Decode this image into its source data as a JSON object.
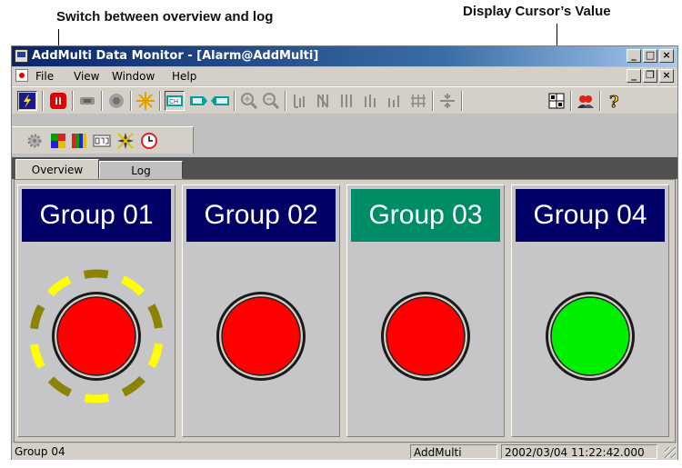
{
  "callouts": {
    "tabs_note": "Switch between overview and log",
    "cursor_note": "Display Cursor’s Value"
  },
  "window": {
    "title": "AddMulti Data Monitor - [Alarm@AddMulti]",
    "controls": {
      "minimize": "_",
      "maximize": "□",
      "close": "×",
      "restore": "❐"
    }
  },
  "menubar": {
    "items": [
      "File",
      "View",
      "Window",
      "Help"
    ]
  },
  "toolbar1": {
    "icons": [
      "alarm-lightning-icon",
      "stop-icon",
      "pause-icon",
      "record-icon",
      "sparkle-icon",
      "channel-icon",
      "tag-icon",
      "tag-comment-icon",
      "zoom-in-icon",
      "zoom-out-icon",
      "bar-scale-1-icon",
      "bar-scale-2-icon",
      "bar-scale-3-icon",
      "bar-scale-4-icon",
      "bar-scale-5-icon",
      "bar-scale-6-icon",
      "center-line-icon",
      "cursor-value-icon",
      "users-icon",
      "help-icon"
    ]
  },
  "toolbar2": {
    "icons": [
      "settings-gear-icon",
      "color-grid-icon",
      "color-bars-icon",
      "digital-display-icon",
      "star-icon",
      "clock-icon"
    ]
  },
  "tabs": [
    {
      "label": "Overview",
      "active": true
    },
    {
      "label": "Log",
      "active": false
    }
  ],
  "groups": [
    {
      "name": "Group 01",
      "header_color": "#000066",
      "lamp_color": "#ff0000",
      "alarm_ring": true
    },
    {
      "name": "Group 02",
      "header_color": "#000066",
      "lamp_color": "#ff0000",
      "alarm_ring": false
    },
    {
      "name": "Group 03",
      "header_color": "#008c66",
      "lamp_color": "#ff0000",
      "alarm_ring": false
    },
    {
      "name": "Group 04",
      "header_color": "#000066",
      "lamp_color": "#00ee00",
      "alarm_ring": false
    }
  ],
  "statusbar": {
    "left": "Group 04",
    "middle": "AddMulti",
    "right": "2002/03/04 11:22:42.000"
  }
}
